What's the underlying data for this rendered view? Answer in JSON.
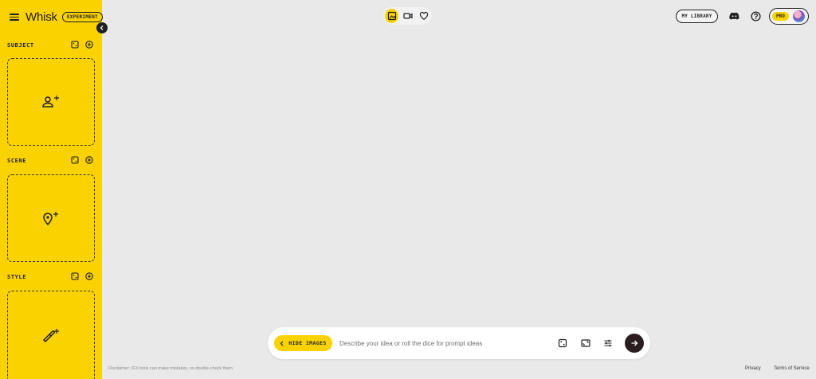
{
  "app": {
    "name": "Whisk",
    "badge": "EXPERIMENT"
  },
  "sidebar": {
    "sections": [
      {
        "title": "SUBJECT",
        "icon": "person-add-icon"
      },
      {
        "title": "SCENE",
        "icon": "location-add-icon"
      },
      {
        "title": "STYLE",
        "icon": "brush-add-icon"
      }
    ]
  },
  "header": {
    "mode_toggle": [
      "image-mode-icon",
      "video-mode-icon",
      "favorites-heart-icon"
    ],
    "library_label": "MY LIBRARY",
    "pro_label": "PRO"
  },
  "prompt": {
    "hide_images_label": "HIDE IMAGES",
    "placeholder": "Describe your idea or roll the dice for prompt ideas"
  },
  "footer": {
    "disclaimer": "Disclaimer: /FX tools can make mistakes, so double-check them",
    "privacy": "Privacy",
    "terms": "Terms of Service"
  },
  "colors": {
    "accent": "#f9d200",
    "background": "#e9e9e9",
    "dark": "#1f1f1f",
    "send": "#2a1d1f"
  }
}
